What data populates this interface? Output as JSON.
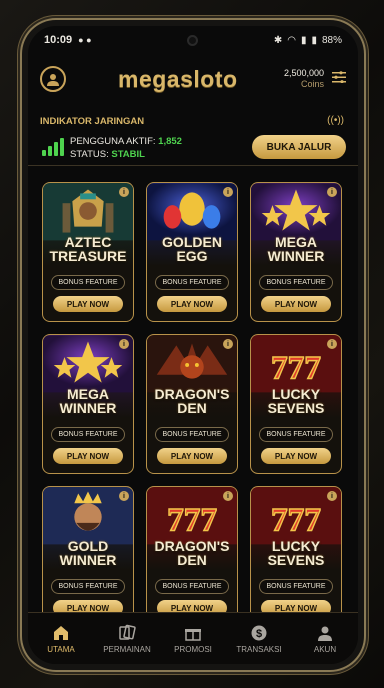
{
  "status": {
    "time": "10:09",
    "battery": "88%"
  },
  "header": {
    "logo": "megasloto",
    "coins_value": "2,500,000",
    "coins_label": "Coins"
  },
  "network": {
    "title": "INDIKATOR JARINGAN",
    "active_label": "PENGGUNA AKTIF:",
    "active_value": "1,852",
    "status_label": "STATUS:",
    "status_value": "STABIL",
    "button": "BUKA JALUR"
  },
  "cards": [
    {
      "title1": "AZTEC",
      "title2": "TREASURE",
      "feature": "BONUS FEATURE",
      "play": "PLAY NOW",
      "art": "pharaoh"
    },
    {
      "title1": "GOLDEN",
      "title2": "EGG",
      "feature": "BONUS FEATURE",
      "play": "PLAY NOW",
      "art": "eggs"
    },
    {
      "title1": "MEGA",
      "title2": "WINNER",
      "feature": "BONUS FEATURE",
      "play": "PLAY NOW",
      "art": "stars"
    },
    {
      "title1": "MEGA",
      "title2": "WINNER",
      "feature": "BONUS FEATURE",
      "play": "PLAY NOW",
      "art": "stars"
    },
    {
      "title1": "DRAGON'S",
      "title2": "DEN",
      "feature": "BONUS FEATURE",
      "play": "PLAY NOW",
      "art": "dragon"
    },
    {
      "title1": "LUCKY",
      "title2": "SEVENS",
      "feature": "BONUS FEATURE",
      "play": "PLAY NOW",
      "art": "777"
    },
    {
      "title1": "GOLD",
      "title2": "WINNER",
      "feature": "BONUS FEATURE",
      "play": "PLAY NOW",
      "art": "king"
    },
    {
      "title1": "DRAGON'S",
      "title2": "DEN",
      "feature": "BONUS FEATURE",
      "play": "PLAY NOW",
      "art": "777"
    },
    {
      "title1": "LUCKY",
      "title2": "SEVENS",
      "feature": "BONUS FEATURE",
      "play": "PLAY NOW",
      "art": "777"
    }
  ],
  "nav": [
    {
      "label": "UTAMA",
      "icon": "home-icon",
      "active": true
    },
    {
      "label": "PERMAINAN",
      "icon": "cards-icon",
      "active": false
    },
    {
      "label": "PROMOSI",
      "icon": "gift-icon",
      "active": false
    },
    {
      "label": "TRANSAKSI",
      "icon": "dollar-icon",
      "active": false
    },
    {
      "label": "AKUN",
      "icon": "user-icon",
      "active": false
    }
  ],
  "colors": {
    "gold": "#d9b76a",
    "green": "#4fd34f",
    "background": "#0a0a0a"
  }
}
